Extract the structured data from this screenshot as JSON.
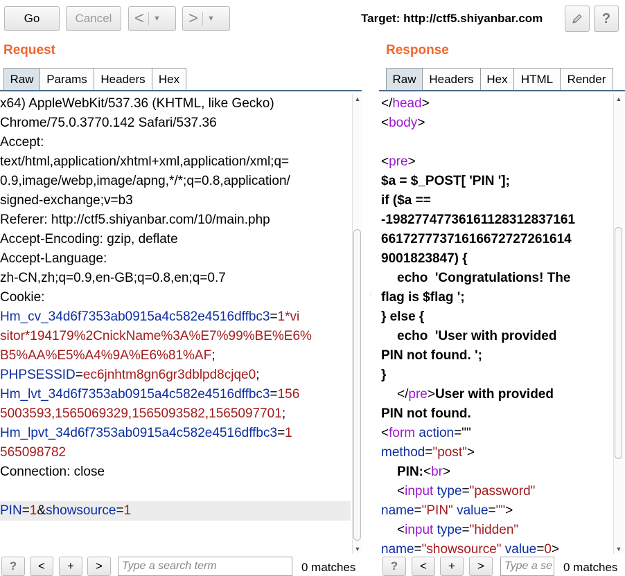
{
  "toolbar": {
    "go_label": "Go",
    "cancel_label": "Cancel",
    "back_arrow": "<",
    "forward_arrow": ">",
    "dropdown_glyph": "▼",
    "target_label": "Target: http://ctf5.shiyanbar.com",
    "edit_icon": "pencil-icon",
    "help_label": "?"
  },
  "request": {
    "title": "Request",
    "tabs": [
      "Raw",
      "Params",
      "Headers",
      "Hex"
    ],
    "active_tab": "Raw",
    "lines": {
      "l0": "x64) AppleWebKit/537.36 (KHTML, like Gecko)",
      "l1": "Chrome/75.0.3770.142 Safari/537.36",
      "l2": "Accept:",
      "l3": "text/html,application/xhtml+xml,application/xml;q=",
      "l4": "0.9,image/webp,image/apng,*/*;q=0.8,application/",
      "l5": "signed-exchange;v=b3",
      "l6": "Referer: http://ctf5.shiyanbar.com/10/main.php",
      "l7": "Accept-Encoding: gzip, deflate",
      "l8": "Accept-Language:",
      "l9": "zh-CN,zh;q=0.9,en-GB;q=0.8,en;q=0.7",
      "l10": "Cookie:",
      "l11k": "Hm_cv_34d6f7353ab0915a4c582e4516dffbc3",
      "l11v": "1*vi",
      "l12": "sitor*194179%2CnickName%3A%E7%99%BE%E6%",
      "l13": "B5%AA%E5%A4%9A%E6%81%AF",
      "l14k": "PHPSESSID",
      "l14v": "ec6jnhtm8gn6gr3dblpd8cjqe0",
      "l15k": "Hm_lvt_34d6f7353ab0915a4c582e4516dffbc3",
      "l15v": "156",
      "l16": "5003593,1565069329,1565093582,1565097701",
      "l17k": "Hm_lpvt_34d6f7353ab0915a4c582e4516dffbc3",
      "l17v": "1",
      "l18": "565098782",
      "l19": "Connection: close",
      "l21k1": "PIN",
      "l21v1": "1",
      "l21k2": "showsource",
      "l21v2": "1"
    },
    "search_placeholder": "Type a search term",
    "matches": "0 matches"
  },
  "response": {
    "title": "Response",
    "tabs": [
      "Raw",
      "Headers",
      "Hex",
      "HTML",
      "Render"
    ],
    "active_tab": "Raw",
    "lines": {
      "head_tag": "head",
      "body_tag": "body",
      "pre_tag": "pre",
      "c1": "$a = $_POST[ 'PIN '];",
      "c2": "if ($a ==",
      "c3": "-198277477361611283128371 61",
      "c3a": "-19827747736161128312837161",
      "c4": "661727773716166727272616 14",
      "c4a": "6617277737161667272726161 4",
      "c4b": "66172777371616672727261614",
      "c5": "9001823847) {",
      "c6": "echo  'Congratulations! The",
      "c7": "flag is $flag ';",
      "c8": "} else {",
      "c9": "echo  'User with provided",
      "c10": "PIN not found. ';",
      "c11": "}",
      "c12": "User with provided",
      "c13": "PIN not found.",
      "form_tag": "form",
      "action_attr": "action",
      "action_val": "\"\"",
      "method_attr": "method",
      "method_val": "\"post\"",
      "pin_label": "PIN:",
      "br_tag": "br",
      "input_tag": "input",
      "type_attr": "type",
      "password_val": "\"password\"",
      "name_attr": "name",
      "pin_val": "\"PIN\"",
      "value_attr": "value",
      "empty_val": "\"\"",
      "hidden_val": "\"hidden\"",
      "showsource_val": "\"showsource\"",
      "zero_val": "0"
    },
    "search_placeholder": "Type a se",
    "matches": "0 matches"
  },
  "search_bar": {
    "help_label": "?",
    "prev_label": "<",
    "add_label": "+",
    "next_label": ">"
  }
}
